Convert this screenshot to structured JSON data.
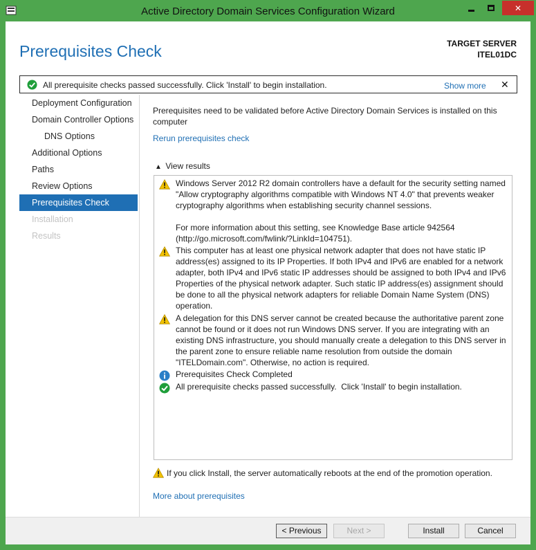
{
  "window": {
    "title": "Active Directory Domain Services Configuration Wizard"
  },
  "header": {
    "page_title": "Prerequisites Check",
    "target_label": "TARGET SERVER",
    "target_name": "ITEL01DC"
  },
  "banner": {
    "message": "All prerequisite checks passed successfully.  Click 'Install' to begin installation.",
    "show_more": "Show more",
    "close": "✕"
  },
  "sidebar": {
    "items": [
      {
        "label": "Deployment Configuration",
        "state": "normal"
      },
      {
        "label": "Domain Controller Options",
        "state": "normal"
      },
      {
        "label": "DNS Options",
        "state": "sub"
      },
      {
        "label": "Additional Options",
        "state": "normal"
      },
      {
        "label": "Paths",
        "state": "normal"
      },
      {
        "label": "Review Options",
        "state": "normal"
      },
      {
        "label": "Prerequisites Check",
        "state": "active"
      },
      {
        "label": "Installation",
        "state": "disabled"
      },
      {
        "label": "Results",
        "state": "disabled"
      }
    ]
  },
  "main": {
    "intro": "Prerequisites need to be validated before Active Directory Domain Services is installed on this computer",
    "rerun_link": "Rerun prerequisites check",
    "view_results": "View results",
    "results": [
      {
        "icon": "warning",
        "text": "Windows Server 2012 R2 domain controllers have a default for the security setting named \"Allow cryptography algorithms compatible with Windows NT 4.0\" that prevents weaker cryptography algorithms when establishing security channel sessions.\n\nFor more information about this setting, see Knowledge Base article 942564 (http://go.microsoft.com/fwlink/?LinkId=104751)."
      },
      {
        "icon": "warning",
        "text": "This computer has at least one physical network adapter that does not have static IP address(es) assigned to its IP Properties. If both IPv4 and IPv6 are enabled for a network adapter, both IPv4 and IPv6 static IP addresses should be assigned to both IPv4 and IPv6 Properties of the physical network adapter. Such static IP address(es) assignment should be done to all the physical network adapters for reliable Domain Name System (DNS) operation."
      },
      {
        "icon": "warning",
        "text": "A delegation for this DNS server cannot be created because the authoritative parent zone cannot be found or it does not run Windows DNS server. If you are integrating with an existing DNS infrastructure, you should manually create a delegation to this DNS server in the parent zone to ensure reliable name resolution from outside the domain \"ITELDomain.com\". Otherwise, no action is required."
      },
      {
        "icon": "info",
        "text": "Prerequisites Check Completed"
      },
      {
        "icon": "success",
        "text": "All prerequisite checks passed successfully.  Click 'Install' to begin installation."
      }
    ],
    "footer_warning": "If you click Install, the server automatically reboots at the end of the promotion operation.",
    "more_link": "More about prerequisites"
  },
  "buttons": {
    "previous": "< Previous",
    "next": "Next >",
    "install": "Install",
    "cancel": "Cancel"
  },
  "colors": {
    "frame": "#4ea64e",
    "accent": "#1f6fb4",
    "warning": "#f2c200",
    "success": "#1f9e3a",
    "info": "#2b7fc7",
    "close": "#c7302b"
  }
}
